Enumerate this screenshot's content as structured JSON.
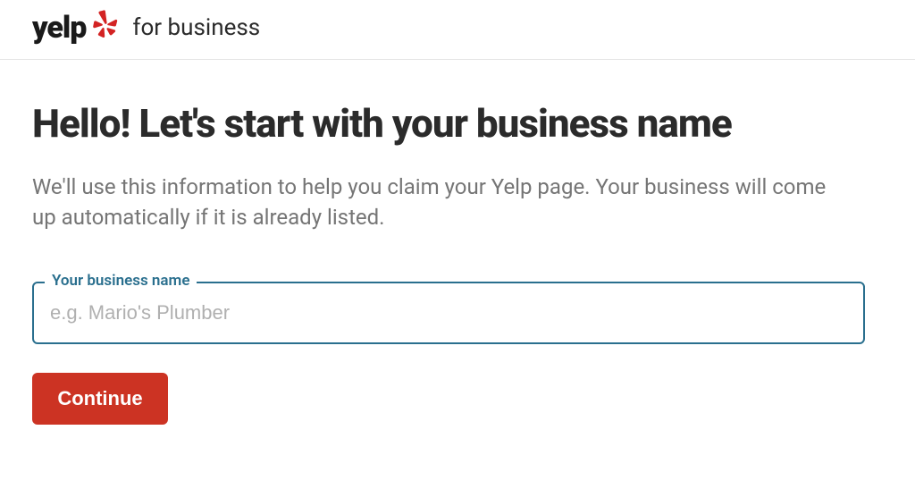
{
  "header": {
    "logo_text": "yelp",
    "logo_icon": "yelp-burst-icon",
    "sub_label": "for business"
  },
  "main": {
    "title": "Hello! Let's start with your business name",
    "subtitle": "We'll use this information to help you claim your Yelp page. Your business will come up automatically if it is already listed.",
    "field": {
      "label": "Your business name",
      "placeholder": "e.g. Mario's Plumber",
      "value": ""
    },
    "continue_label": "Continue"
  },
  "colors": {
    "accent_red": "#cc3323",
    "field_border": "#2a6f8e",
    "text_dark": "#2b2b2b",
    "text_muted": "#757575"
  }
}
